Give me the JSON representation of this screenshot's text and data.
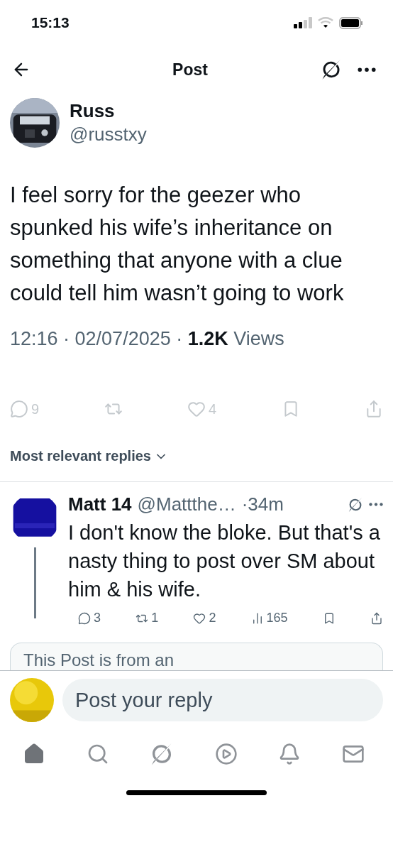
{
  "status_bar": {
    "time": "15:13"
  },
  "header": {
    "title": "Post"
  },
  "post": {
    "author": "Russ",
    "handle": "@russtxy",
    "text": "I feel sorry for the geezer who spunked his wife’s inheritance on something that anyone with a clue could tell him wasn’t going to work",
    "meta": "12:16 · 02/07/2025 · **1.2K** Views",
    "actions": [
      {
        "kind": "reply",
        "count": "9"
      },
      {
        "kind": "repost"
      },
      {
        "kind": "like",
        "count": "4"
      },
      {
        "kind": "bookmark"
      },
      {
        "kind": "share"
      }
    ]
  },
  "sort": {
    "label": "Most relevant replies"
  },
  "reply": {
    "author": "Matt 14",
    "handle": "@Mattthe…",
    "time": "·34m",
    "text": "I don't know the bloke. But that's a nasty thing to post over SM about him & his wife.",
    "actions": [
      {
        "kind": "reply",
        "count": "3"
      },
      {
        "kind": "repost",
        "count": "1"
      },
      {
        "kind": "like",
        "count": "2"
      },
      {
        "kind": "views",
        "count": "165"
      },
      {
        "kind": "bookmark"
      },
      {
        "kind": "share"
      }
    ],
    "quote": {
      "text": "This Post is from an"
    }
  },
  "composer": {
    "placeholder": "Post your reply"
  },
  "nav": [
    {
      "kind": "home",
      "selected": true
    },
    {
      "kind": "search",
      "selected": false
    },
    {
      "kind": "grok",
      "selected": false
    },
    {
      "kind": "video",
      "selected": false
    },
    {
      "kind": "notifications",
      "selected": false
    },
    {
      "kind": "messages",
      "selected": false
    }
  ]
}
